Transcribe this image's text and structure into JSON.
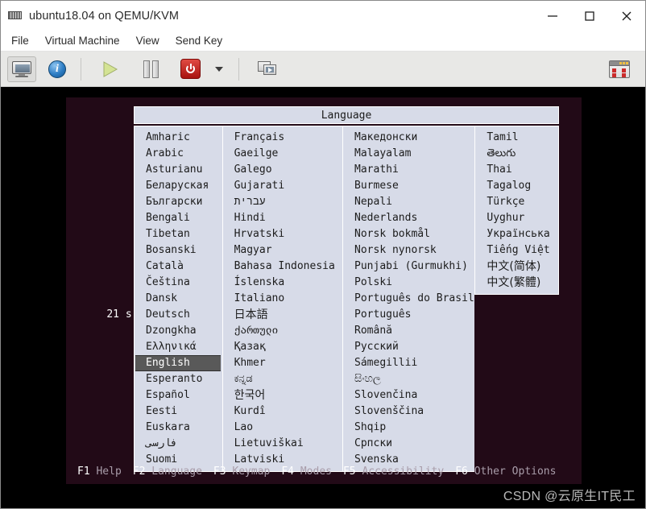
{
  "window": {
    "title": "ubuntu18.04 on QEMU/KVM",
    "icon": "vm-display-icon",
    "controls": {
      "minimize": "minimize-icon",
      "maximize": "maximize-icon",
      "close": "close-icon"
    }
  },
  "menubar": {
    "items": [
      {
        "label": "File"
      },
      {
        "label": "Virtual Machine"
      },
      {
        "label": "View"
      },
      {
        "label": "Send Key"
      }
    ]
  },
  "toolbar": {
    "buttons": [
      {
        "name": "show-console-button",
        "icon": "monitor-icon"
      },
      {
        "name": "show-details-button",
        "icon": "info-icon"
      },
      {
        "name": "run-button",
        "icon": "play-icon"
      },
      {
        "name": "pause-button",
        "icon": "pause-icon"
      },
      {
        "name": "shutdown-button",
        "icon": "power-icon"
      },
      {
        "name": "shutdown-menu-button",
        "icon": "chevron-down-icon"
      },
      {
        "name": "fullscreen-button",
        "icon": "screens-icon"
      },
      {
        "name": "snapshots-button",
        "icon": "snapshot-icon"
      }
    ]
  },
  "console": {
    "timer": "21 s",
    "dialog": {
      "title": "Language",
      "selected": "English",
      "columns": [
        {
          "name": "language-column-1",
          "items": [
            "Amharic",
            "Arabic",
            "Asturianu",
            "Беларуская",
            "Български",
            "Bengali",
            "Tibetan",
            "Bosanski",
            "Català",
            "Čeština",
            "Dansk",
            "Deutsch",
            "Dzongkha",
            "Ελληνικά",
            "English",
            "Esperanto",
            "Español",
            "Eesti",
            "Euskara",
            "فارسی",
            "Suomi"
          ]
        },
        {
          "name": "language-column-2",
          "items": [
            "Français",
            "Gaeilge",
            "Galego",
            "Gujarati",
            "עברית",
            "Hindi",
            "Hrvatski",
            "Magyar",
            "Bahasa Indonesia",
            "Íslenska",
            "Italiano",
            "日本語",
            "ქართული",
            "Қазақ",
            "Khmer",
            "ಕನ್ನಡ",
            "한국어",
            "Kurdî",
            "Lao",
            "Lietuviškai",
            "Latviski"
          ]
        },
        {
          "name": "language-column-3",
          "items": [
            "Македонски",
            "Malayalam",
            "Marathi",
            "Burmese",
            "Nepali",
            "Nederlands",
            "Norsk bokmål",
            "Norsk nynorsk",
            "Punjabi (Gurmukhi)",
            "Polski",
            "Português do Brasil",
            "Português",
            "Română",
            "Русский",
            "Sámegillii",
            "සිංහල",
            "Slovenčina",
            "Slovenščina",
            "Shqip",
            "Српски",
            "Svenska"
          ]
        },
        {
          "name": "language-column-4",
          "items": [
            "Tamil",
            "తెలుగు",
            "Thai",
            "Tagalog",
            "Türkçe",
            "Uyghur",
            "Українська",
            "Tiếng Việt",
            "中文(简体)",
            "中文(繁體)"
          ]
        }
      ]
    },
    "function_keys": [
      {
        "key": "F1",
        "desc": "Help"
      },
      {
        "key": "F2",
        "desc": "Language"
      },
      {
        "key": "F3",
        "desc": "Keymap"
      },
      {
        "key": "F4",
        "desc": "Modes"
      },
      {
        "key": "F5",
        "desc": "Accessibility"
      },
      {
        "key": "F6",
        "desc": "Other Options"
      }
    ]
  },
  "watermark": "CSDN @云原生IT民工",
  "colors": {
    "console_bg": "#220a17",
    "dialog_bg": "#d7dbe8",
    "selection_bg": "#595959",
    "fkey_label": "#ffffff",
    "fkey_desc": "#a99daa"
  }
}
